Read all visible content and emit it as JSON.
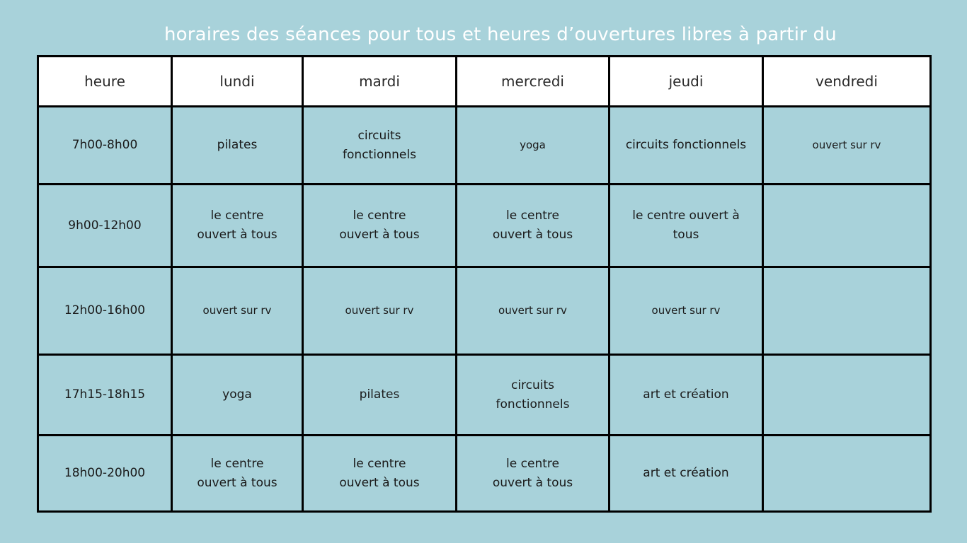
{
  "title": "horaires des séances pour tous et heures d’ouvertures libres à partir du",
  "colors": {
    "background": "#a8d2da",
    "header_bg": "#ffffff",
    "border": "#000000",
    "title_text": "#ffffff"
  },
  "table": {
    "headers": [
      "heure",
      "lundi",
      "mardi",
      "mercredi",
      "jeudi",
      "vendredi"
    ],
    "rows": [
      [
        "7h00-8h00",
        "pilates",
        "circuits\nfonctionnels",
        "yoga",
        "circuits fonctionnels",
        "ouvert sur rv"
      ],
      [
        "9h00-12h00",
        "le centre\nouvert à tous",
        "le centre\nouvert à tous",
        "le centre\nouvert à tous",
        "le centre ouvert à\ntous",
        ""
      ],
      [
        "12h00-16h00",
        "ouvert sur rv",
        "ouvert sur rv",
        "ouvert sur rv",
        "ouvert sur rv",
        ""
      ],
      [
        "17h15-18h15",
        "yoga",
        "pilates",
        "circuits\nfonctionnels",
        "art et création",
        ""
      ],
      [
        "18h00-20h00",
        "le centre\nouvert à tous",
        "le centre\nouvert à tous",
        "le centre\nouvert à tous",
        "art et création",
        ""
      ]
    ]
  }
}
